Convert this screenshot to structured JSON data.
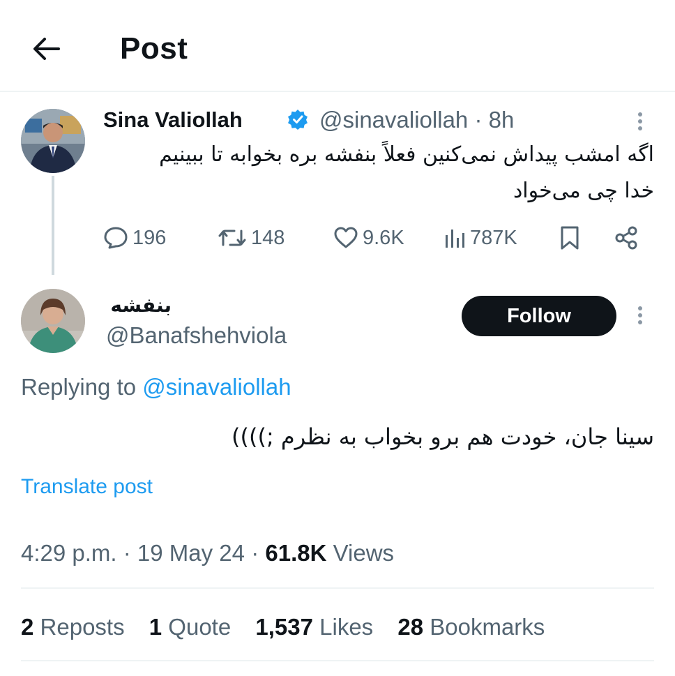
{
  "header": {
    "title": "Post",
    "back_icon": "arrow-left-icon"
  },
  "tweet": {
    "author_name": "Sina Valiollah",
    "verified": true,
    "handle": "@sinavaliollah",
    "separator": "·",
    "age": "8h",
    "text_line1": "اگه امشب پیداش نمی‌کنین فعلاً بنفشه بره بخوابه تا ببینیم",
    "text_line2": "خدا چی می‌خواد",
    "actions": {
      "replies": "196",
      "reposts": "148",
      "likes": "9.6K",
      "views": "787K"
    }
  },
  "reply": {
    "author_name": "بنفشه",
    "handle": "@Banafshehviola",
    "follow_label": "Follow",
    "replying_prefix": "Replying to",
    "replying_handle": "@sinavaliollah",
    "text": "سینا جان، خودت هم برو بخواب به نظرم ;))))",
    "translate_label": "Translate post",
    "time": "4:29 p.m.",
    "date": "19 May 24",
    "dot": "·",
    "views_count": "61.8K",
    "views_label": "Views",
    "stats": {
      "reposts_count": "2",
      "reposts_label": "Reposts",
      "quotes_count": "1",
      "quotes_label": "Quote",
      "likes_count": "1,537",
      "likes_label": "Likes",
      "bookmarks_count": "28",
      "bookmarks_label": "Bookmarks"
    }
  },
  "colors": {
    "accent": "#1d9bf0",
    "text": "#0f1419",
    "muted": "#536471",
    "border": "#eff3f4"
  }
}
